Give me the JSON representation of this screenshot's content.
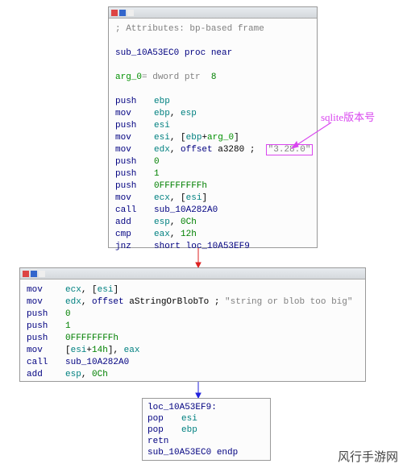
{
  "annotation": {
    "label": "sqlite版本号"
  },
  "panel1": {
    "attr_comment": "; Attributes: bp-based frame",
    "proc_line": {
      "name": "sub_10A53EC0",
      "decl": "proc near"
    },
    "arg_line": {
      "name": "arg_0",
      "eq": "= dword ptr",
      "val": "8"
    },
    "lines": [
      {
        "m": "push",
        "ops": [
          [
            "reg",
            "ebp"
          ]
        ]
      },
      {
        "m": "mov",
        "ops": [
          [
            "reg",
            "ebp"
          ],
          [
            "txt",
            ", "
          ],
          [
            "reg",
            "esp"
          ]
        ]
      },
      {
        "m": "push",
        "ops": [
          [
            "reg",
            "esi"
          ]
        ]
      },
      {
        "m": "mov",
        "ops": [
          [
            "reg",
            "esi"
          ],
          [
            "txt",
            ", ["
          ],
          [
            "reg",
            "ebp"
          ],
          [
            "txt",
            "+"
          ],
          [
            "arg",
            "arg_0"
          ],
          [
            "txt",
            "]"
          ]
        ]
      },
      {
        "m": "mov",
        "ops": [
          [
            "reg",
            "edx"
          ],
          [
            "txt",
            ", "
          ],
          [
            "mn",
            "offset"
          ],
          [
            "txt",
            " a3280 ; "
          ]
        ],
        "boxed": "\"3.28.0\""
      },
      {
        "m": "push",
        "ops": [
          [
            "num",
            "0"
          ]
        ]
      },
      {
        "m": "push",
        "ops": [
          [
            "num",
            "1"
          ]
        ]
      },
      {
        "m": "push",
        "ops": [
          [
            "num",
            "0FFFFFFFFh"
          ]
        ]
      },
      {
        "m": "mov",
        "ops": [
          [
            "reg",
            "ecx"
          ],
          [
            "txt",
            ", ["
          ],
          [
            "reg",
            "esi"
          ],
          [
            "txt",
            "]"
          ]
        ]
      },
      {
        "m": "call",
        "ops": [
          [
            "mn",
            "sub_10A282A0"
          ]
        ]
      },
      {
        "m": "add",
        "ops": [
          [
            "reg",
            "esp"
          ],
          [
            "txt",
            ", "
          ],
          [
            "num",
            "0Ch"
          ]
        ]
      },
      {
        "m": "cmp",
        "ops": [
          [
            "reg",
            "eax"
          ],
          [
            "txt",
            ", "
          ],
          [
            "num",
            "12h"
          ]
        ]
      },
      {
        "m": "jnz",
        "ops": [
          [
            "mn",
            "short"
          ],
          [
            "txt",
            " "
          ],
          [
            "mn",
            "loc_10A53EF9"
          ]
        ]
      }
    ]
  },
  "panel2": {
    "lines": [
      {
        "m": "mov",
        "ops": [
          [
            "reg",
            "ecx"
          ],
          [
            "txt",
            ", ["
          ],
          [
            "reg",
            "esi"
          ],
          [
            "txt",
            "]"
          ]
        ]
      },
      {
        "m": "mov",
        "ops": [
          [
            "reg",
            "edx"
          ],
          [
            "txt",
            ", "
          ],
          [
            "mn",
            "offset"
          ],
          [
            "txt",
            " aStringOrBlobTo ; "
          ]
        ],
        "tail": "\"string or blob too big\""
      },
      {
        "m": "push",
        "ops": [
          [
            "num",
            "0"
          ]
        ]
      },
      {
        "m": "push",
        "ops": [
          [
            "num",
            "1"
          ]
        ]
      },
      {
        "m": "push",
        "ops": [
          [
            "num",
            "0FFFFFFFFh"
          ]
        ]
      },
      {
        "m": "mov",
        "ops": [
          [
            "txt",
            "["
          ],
          [
            "reg",
            "esi"
          ],
          [
            "txt",
            "+"
          ],
          [
            "num",
            "14h"
          ],
          [
            "txt",
            "], "
          ],
          [
            "reg",
            "eax"
          ]
        ]
      },
      {
        "m": "call",
        "ops": [
          [
            "mn",
            "sub_10A282A0"
          ]
        ]
      },
      {
        "m": "add",
        "ops": [
          [
            "reg",
            "esp"
          ],
          [
            "txt",
            ", "
          ],
          [
            "num",
            "0Ch"
          ]
        ]
      }
    ]
  },
  "panel3": {
    "label": "loc_10A53EF9:",
    "lines": [
      {
        "m": "pop",
        "ops": [
          [
            "reg",
            "esi"
          ]
        ]
      },
      {
        "m": "pop",
        "ops": [
          [
            "reg",
            "ebp"
          ]
        ]
      },
      {
        "m": "retn",
        "ops": []
      }
    ],
    "endp": {
      "name": "sub_10A53EC0",
      "decl": "endp"
    }
  },
  "watermark": "风行手游网"
}
